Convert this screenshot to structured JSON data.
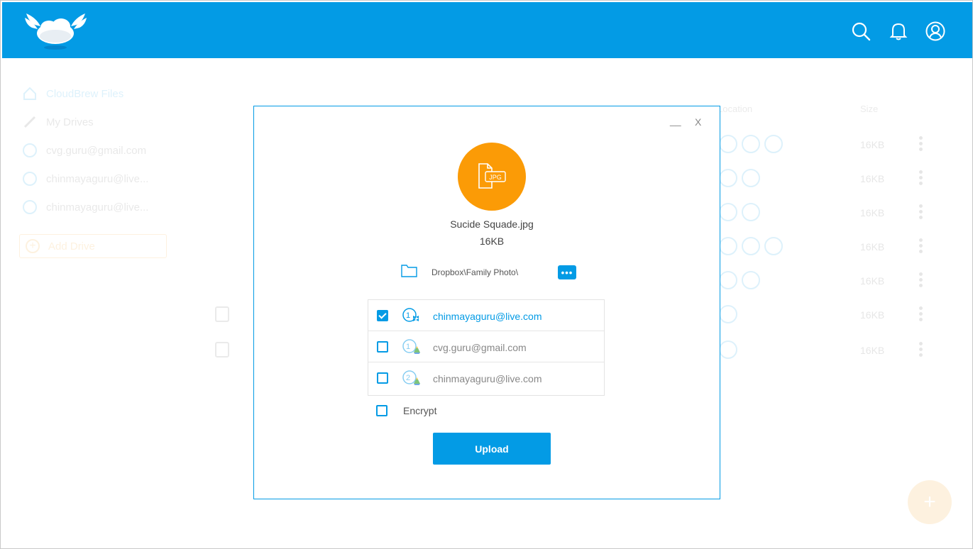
{
  "header": {
    "logo_alt": "CloudBrew",
    "icons": [
      "search-icon",
      "bell-icon",
      "user-icon"
    ],
    "color": "#039be5"
  },
  "sidebar": {
    "items": [
      {
        "label": "CloudBrew Files",
        "icon": "home-icon"
      },
      {
        "label": "My Drives",
        "icon": "link-icon"
      },
      {
        "label": "cvg.guru@gmail.com",
        "icon": "drive-1-icon"
      },
      {
        "label": "chinmayaguru@live...",
        "icon": "drive-2-icon"
      },
      {
        "label": "chinmayaguru@live...",
        "icon": "dropbox-1-icon"
      }
    ],
    "add_drive": "Add Drive"
  },
  "file_list": {
    "columns": {
      "location": "Location",
      "size": "Size"
    },
    "rows": [
      {
        "size": "16KB"
      },
      {
        "size": "16KB"
      },
      {
        "size": "16KB"
      },
      {
        "size": "16KB"
      },
      {
        "size": "16KB"
      },
      {
        "size": "16KB"
      },
      {
        "size": "16KB"
      }
    ]
  },
  "modal": {
    "minimize": "__",
    "close": "X",
    "file_type": "JPG",
    "file_name": "Sucide Squade.jpg",
    "file_size": "16KB",
    "path": "Dropbox\\Family Photo\\",
    "more_button": "•••",
    "accounts": [
      {
        "email": "chinmayaguru@live.com",
        "checked": true,
        "badge_num": "1",
        "service": "dropbox"
      },
      {
        "email": "cvg.guru@gmail.com",
        "checked": false,
        "badge_num": "1",
        "service": "google-drive"
      },
      {
        "email": "chinmayaguru@live.com",
        "checked": false,
        "badge_num": "2",
        "service": "google-drive"
      }
    ],
    "encrypt_label": "Encrypt",
    "encrypt_checked": false,
    "upload_label": "Upload",
    "accent_color": "#039be5",
    "file_badge_color": "#fb9b06"
  }
}
